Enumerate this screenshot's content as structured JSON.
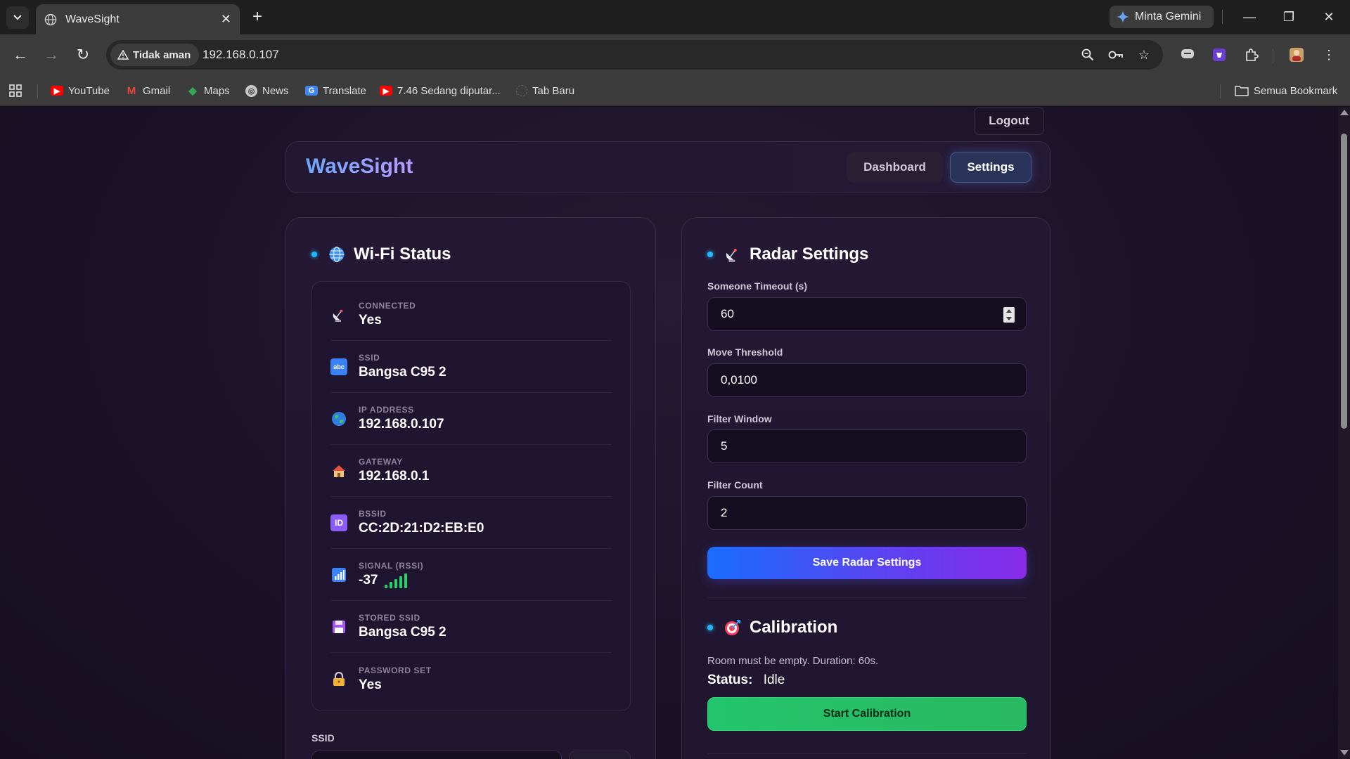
{
  "browser": {
    "tab_title": "WaveSight",
    "close_tab": "✕",
    "new_tab": "+",
    "gemini_label": "Minta Gemini",
    "security_label": "Tidak aman",
    "url": "192.168.0.107",
    "bookmarks": [
      {
        "label": "YouTube"
      },
      {
        "label": "Gmail"
      },
      {
        "label": "Maps"
      },
      {
        "label": "News"
      },
      {
        "label": "Translate"
      },
      {
        "label": "7.46 Sedang diputar..."
      },
      {
        "label": "Tab Baru"
      }
    ],
    "all_bookmarks": "Semua Bookmark"
  },
  "app": {
    "logout": "Logout",
    "brand": "WaveSight",
    "nav": {
      "dashboard": "Dashboard",
      "settings": "Settings"
    }
  },
  "wifi": {
    "title": "Wi-Fi Status",
    "rows": [
      {
        "label": "CONNECTED",
        "value": "Yes",
        "icon": "satellite-dish-icon"
      },
      {
        "label": "SSID",
        "value": "Bangsa C95 2",
        "icon": "abc-icon"
      },
      {
        "label": "IP ADDRESS",
        "value": "192.168.0.107",
        "icon": "globe-icon"
      },
      {
        "label": "GATEWAY",
        "value": "192.168.0.1",
        "icon": "house-icon"
      },
      {
        "label": "BSSID",
        "value": "CC:2D:21:D2:EB:E0",
        "icon": "id-icon"
      },
      {
        "label": "SIGNAL (RSSI)",
        "value": "-37",
        "icon": "signal-chart-icon",
        "signal_bars": 5
      },
      {
        "label": "STORED SSID",
        "value": "Bangsa C95 2",
        "icon": "floppy-disk-icon"
      },
      {
        "label": "PASSWORD SET",
        "value": "Yes",
        "icon": "lock-icon"
      }
    ],
    "ssid_field_label": "SSID"
  },
  "radar": {
    "title": "Radar Settings",
    "fields": [
      {
        "label": "Someone Timeout (s)",
        "value": "60"
      },
      {
        "label": "Move Threshold",
        "value": "0,0100"
      },
      {
        "label": "Filter Window",
        "value": "5"
      },
      {
        "label": "Filter Count",
        "value": "2"
      }
    ],
    "save_button": "Save Radar Settings"
  },
  "calibration": {
    "title": "Calibration",
    "description": "Room must be empty. Duration: 60s.",
    "status_label": "Status:",
    "status_value": "Idle",
    "start_button": "Start Calibration"
  },
  "colors": {
    "accent_dot": "#22b8ff",
    "save_gradient_start": "#1a6dff",
    "save_gradient_end": "#8a2be8",
    "calibrate_green": "#22c46c",
    "signal_green": "#22d36a"
  }
}
